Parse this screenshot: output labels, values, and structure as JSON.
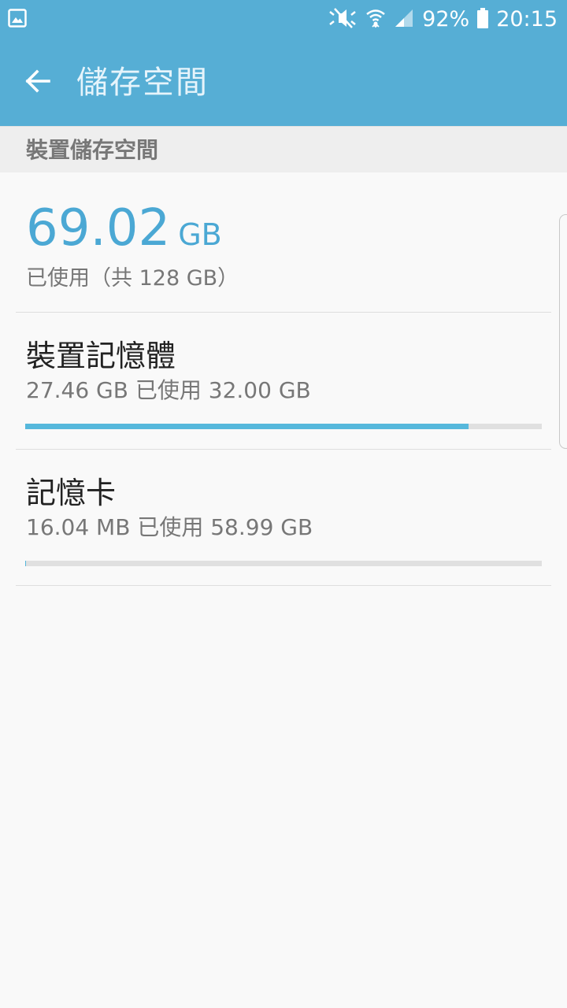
{
  "status_bar": {
    "battery": "92%",
    "time": "20:15",
    "icons": [
      "gallery-icon",
      "mute-icon",
      "wifi-icon",
      "signal-icon",
      "battery-icon"
    ]
  },
  "app_bar": {
    "title": "儲存空間",
    "back_icon": "back-arrow-icon"
  },
  "section": {
    "header": "裝置儲存空間"
  },
  "summary": {
    "used_value": "69.02",
    "used_unit": "GB",
    "total_text": "已使用（共 128 GB）"
  },
  "storage_items": [
    {
      "title": "裝置記憶體",
      "subtitle": "27.46 GB 已使用 32.00 GB",
      "used_fraction": 0.858
    },
    {
      "title": "記憶卡",
      "subtitle": "16.04 MB 已使用 58.99 GB",
      "used_fraction": 0.0003
    }
  ],
  "colors": {
    "accent": "#56aed5",
    "progress": "#56b8dc",
    "track": "#e0e0e0",
    "background": "#f9f9f9"
  }
}
